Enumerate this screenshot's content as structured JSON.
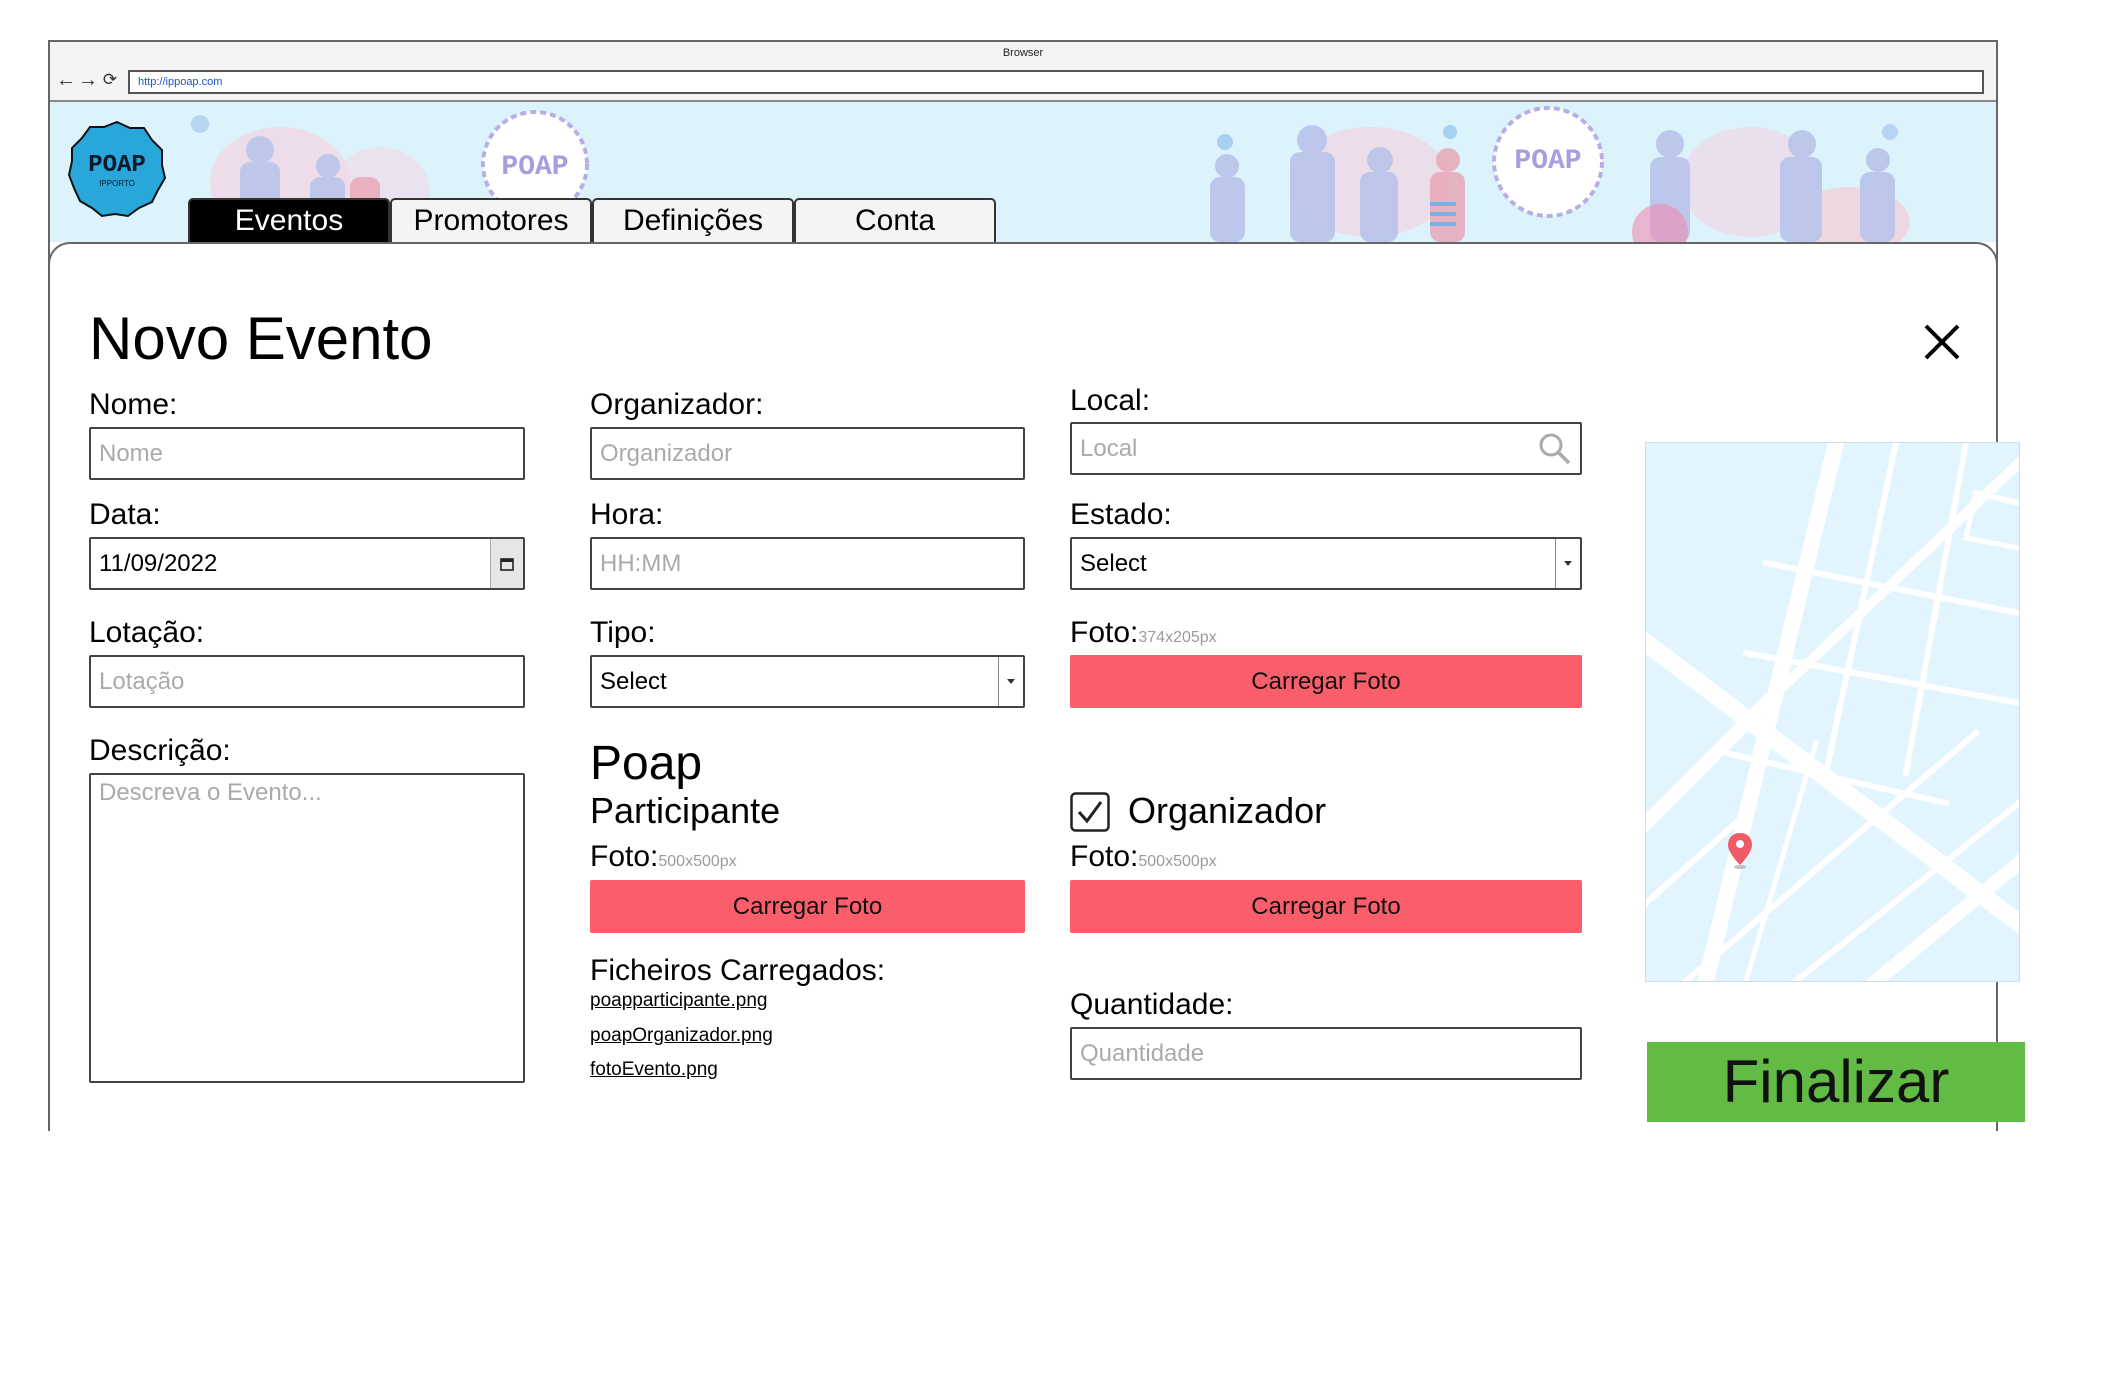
{
  "browser": {
    "title": "Browser",
    "url": "http://ippoap.com"
  },
  "brand": {
    "logo_text": "POAP",
    "logo_sub": "IPPORTO",
    "banner_badge_left": "POAP",
    "banner_badge_right": "POAP"
  },
  "tabs": [
    {
      "label": "Eventos",
      "active": true
    },
    {
      "label": "Promotores",
      "active": false
    },
    {
      "label": "Definições",
      "active": false
    },
    {
      "label": "Conta",
      "active": false
    }
  ],
  "page": {
    "title": "Novo Evento",
    "close_icon": "close-icon"
  },
  "form": {
    "nome": {
      "label": "Nome:",
      "placeholder": "Nome"
    },
    "data": {
      "label": "Data:",
      "value": "11/09/2022"
    },
    "lotacao": {
      "label": "Lotação:",
      "placeholder": "Lotação"
    },
    "descricao": {
      "label": "Descrição:",
      "placeholder": "Descreva o Evento..."
    },
    "organizador": {
      "label": "Organizador:",
      "placeholder": "Organizador"
    },
    "hora": {
      "label": "Hora:",
      "placeholder": "HH:MM"
    },
    "tipo": {
      "label": "Tipo:",
      "value": "Select"
    },
    "local": {
      "label": "Local:",
      "placeholder": "Local"
    },
    "estado": {
      "label": "Estado:",
      "value": "Select"
    },
    "foto": {
      "label": "Foto:",
      "hint": "374x205px",
      "button": "Carregar Foto"
    },
    "quantidade": {
      "label": "Quantidade:",
      "placeholder": "Quantidade"
    }
  },
  "poap_participante": {
    "title": "Poap",
    "subtitle": "Participante",
    "foto_label": "Foto:",
    "foto_hint": "500x500px",
    "button": "Carregar Foto"
  },
  "poap_organizador": {
    "checkbox_checked": true,
    "label": "Organizador",
    "foto_label": "Foto:",
    "foto_hint": "500x500px",
    "button": "Carregar Foto"
  },
  "uploaded_files": {
    "title": "Ficheiros Carregados:",
    "files": [
      "poapparticipante.png",
      "poapOrganizador.png",
      "fotoEvento.png"
    ]
  },
  "finalize_button": "Finalizar",
  "colors": {
    "accent_red": "#fa5e6a",
    "finalize_green": "#62bb45",
    "banner_bg": "#ddf3fc",
    "map_bg": "#e2f4fd"
  }
}
